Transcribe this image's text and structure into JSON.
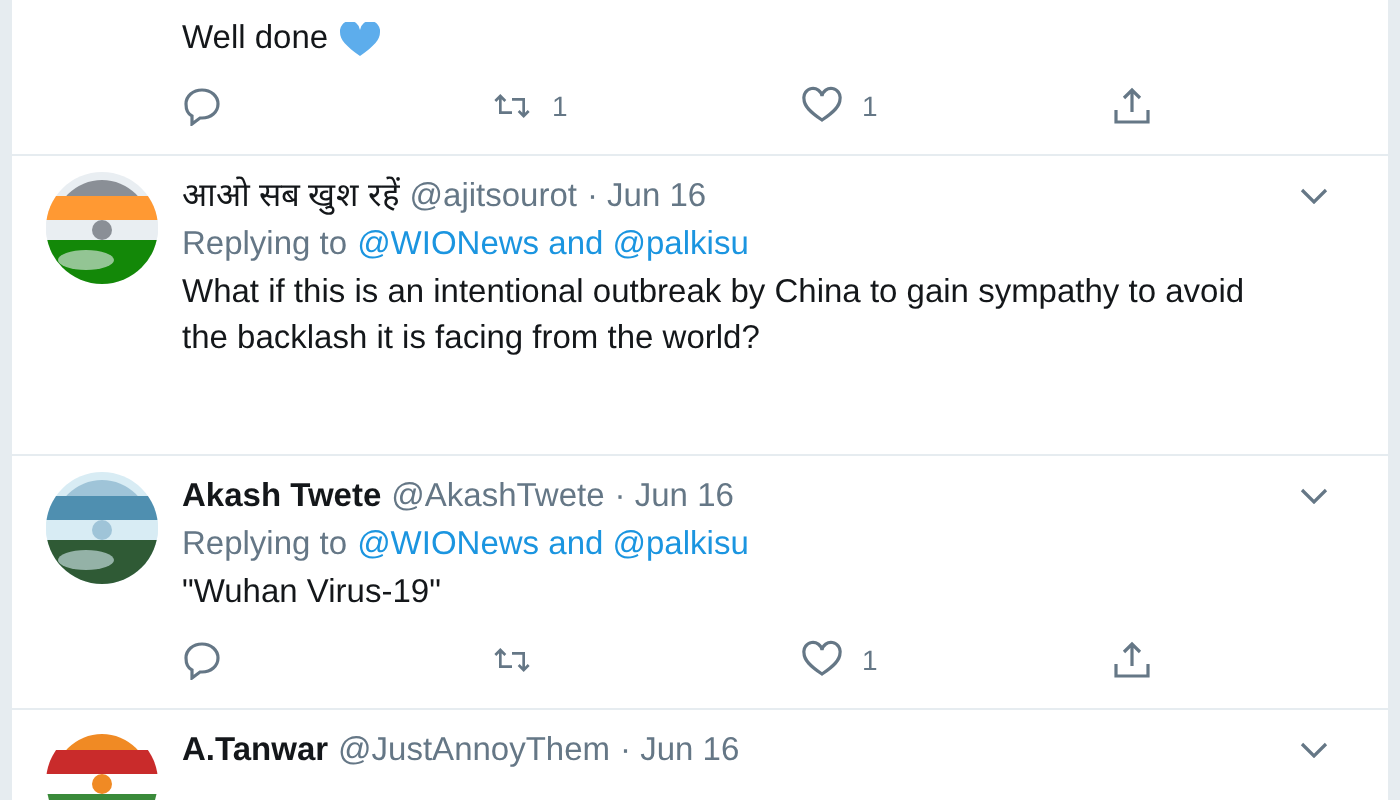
{
  "tweets": [
    {
      "text": "Well done",
      "heart_emoji": true,
      "actions": {
        "retweet": "1",
        "like": "1"
      }
    },
    {
      "author": "आओ सब खुश रहें",
      "bold_author": false,
      "handle": "@ajitsourot",
      "date": "· Jun 16",
      "replying_label": "Replying to",
      "replying_links": "@WIONews and @palkisu",
      "text": "What if this is an intentional outbreak by China to gain sympathy to avoid the backlash it is facing from the world?"
    },
    {
      "author": "Akash Twete",
      "bold_author": true,
      "handle": "@AkashTwete",
      "date": "· Jun 16",
      "replying_label": "Replying to",
      "replying_links": "@WIONews and @palkisu",
      "text": "\"Wuhan Virus-19\"",
      "actions": {
        "like": "1"
      }
    },
    {
      "author": "A.Tanwar",
      "bold_author": true,
      "handle": "@JustAnnoyThem",
      "date": "· Jun 16"
    }
  ]
}
